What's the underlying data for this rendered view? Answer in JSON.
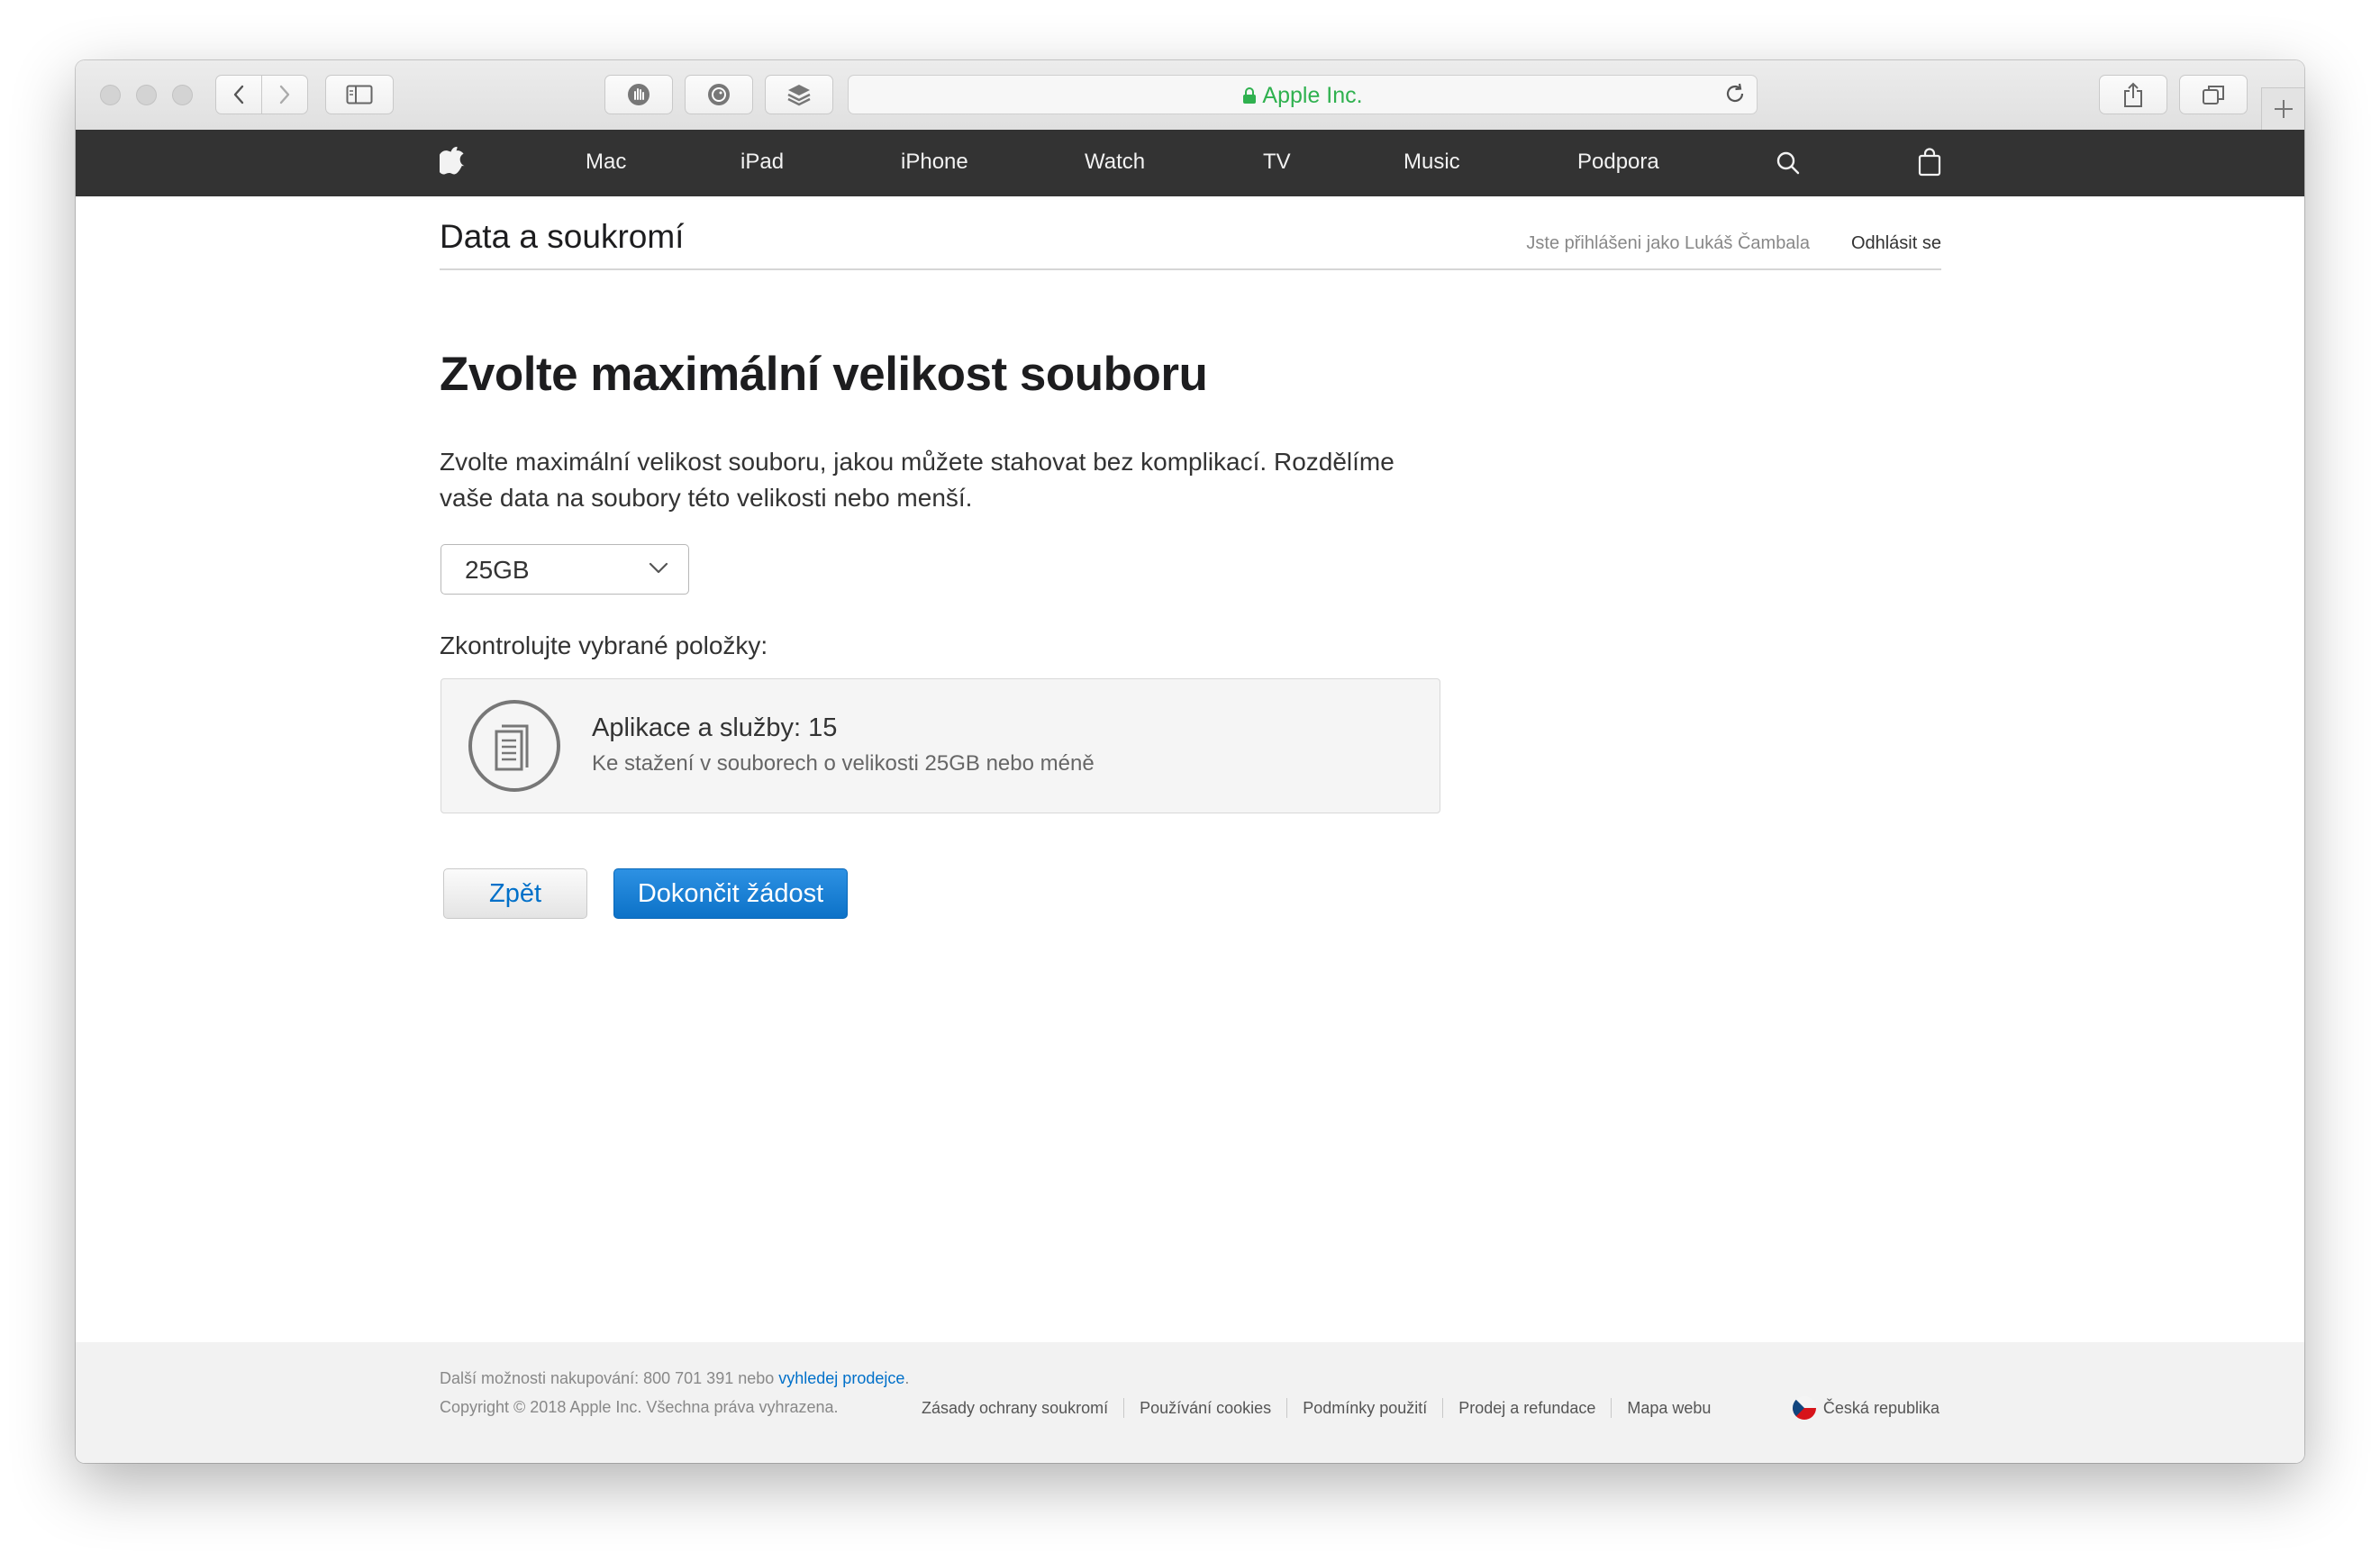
{
  "browser": {
    "address_text": "Apple Inc.",
    "address_color": "#2fb14f"
  },
  "gnav": {
    "items": [
      "Mac",
      "iPad",
      "iPhone",
      "Watch",
      "TV",
      "Music",
      "Podpora"
    ],
    "icons": [
      "apple-logo-icon",
      "search-icon",
      "bag-icon"
    ]
  },
  "localnav": {
    "title": "Data a soukromí",
    "signed_in": "Jste přihlášeni jako Lukáš Čambala",
    "logout": "Odhlásit se"
  },
  "main": {
    "title": "Zvolte maximální velikost souboru",
    "description": "Zvolte maximální velikost souboru, jakou můžete stahovat bez komplikací. Rozdělíme vaše data na soubory této velikosti nebo menší.",
    "file_size_select": {
      "value": "25GB"
    },
    "review_label": "Zkontrolujte vybrané položky:",
    "card": {
      "title": "Aplikace a služby: 15",
      "subtitle": "Ke stažení v souborech o velikosti 25GB nebo méně"
    },
    "buttons": {
      "back": "Zpět",
      "finish": "Dokončit žádost"
    },
    "accent_color": "#0070c9"
  },
  "footer": {
    "shop_text": "Další možnosti nakupování: 800 701 391 nebo ",
    "shop_link": "vyhledej prodejce",
    "shop_suffix": ".",
    "copyright": "Copyright © 2018 Apple Inc. Všechna práva vyhrazena.",
    "links": [
      "Zásady ochrany soukromí",
      "Používání cookies",
      "Podmínky použití",
      "Prodej a refundace",
      "Mapa webu"
    ],
    "region": "Česká republika"
  }
}
